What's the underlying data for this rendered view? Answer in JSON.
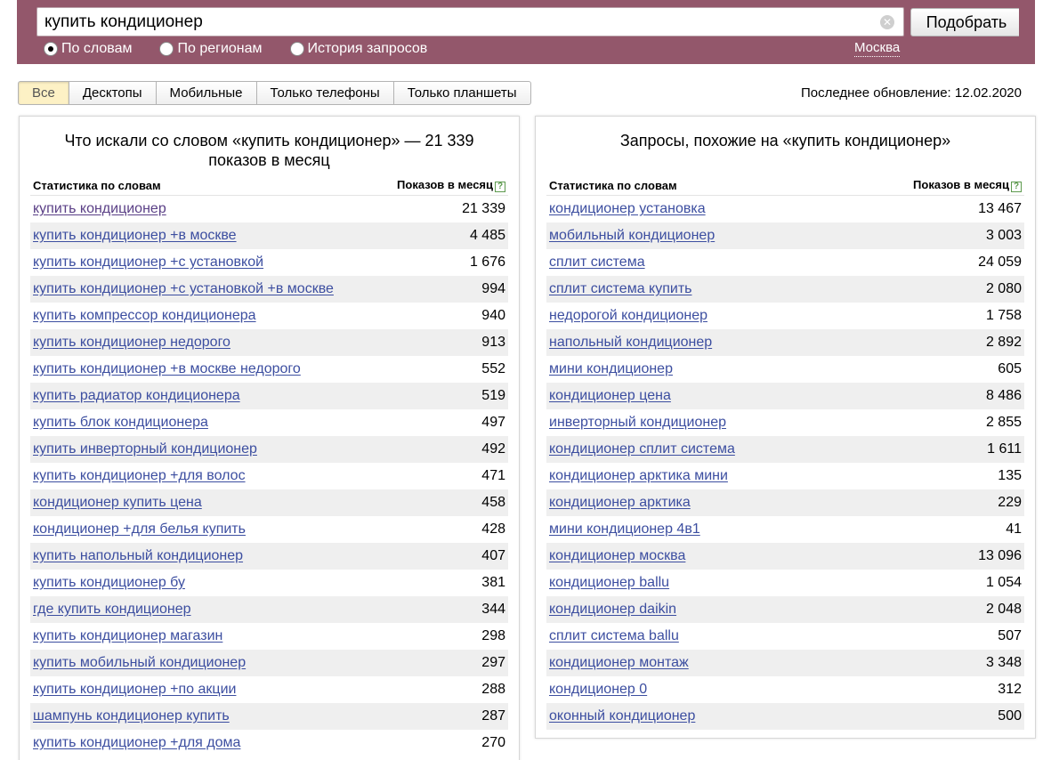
{
  "search": {
    "query": "купить кондиционер",
    "submit_label": "Подобрать",
    "modes": [
      {
        "label": "По словам",
        "checked": true
      },
      {
        "label": "По регионам",
        "checked": false
      },
      {
        "label": "История запросов",
        "checked": false
      }
    ],
    "region": "Москва",
    "colors": {
      "band": "#93576b"
    }
  },
  "tabs": [
    "Все",
    "Десктопы",
    "Мобильные",
    "Только телефоны",
    "Только планшеты"
  ],
  "active_tab": "Все",
  "last_update": "Последнее обновление: 12.02.2020",
  "left_panel": {
    "title": "Что искали со словом «купить кондиционер» — 21 339 показов в месяц",
    "col_words": "Статистика по словам",
    "col_count": "Показов в месяц",
    "rows": [
      {
        "phrase": "купить кондиционер",
        "count": "21 339"
      },
      {
        "phrase": "купить кондиционер +в москве",
        "count": "4 485"
      },
      {
        "phrase": "купить кондиционер +с установкой",
        "count": "1 676"
      },
      {
        "phrase": "купить кондиционер +с установкой +в москве",
        "count": "994"
      },
      {
        "phrase": "купить компрессор кондиционера",
        "count": "940"
      },
      {
        "phrase": "купить кондиционер недорого",
        "count": "913"
      },
      {
        "phrase": "купить кондиционер +в москве недорого",
        "count": "552"
      },
      {
        "phrase": "купить радиатор кондиционера",
        "count": "519"
      },
      {
        "phrase": "купить блок кондиционера",
        "count": "497"
      },
      {
        "phrase": "купить инверторный кондиционер",
        "count": "492"
      },
      {
        "phrase": "купить кондиционер +для волос",
        "count": "471"
      },
      {
        "phrase": "кондиционер купить цена",
        "count": "458"
      },
      {
        "phrase": "кондиционер +для белья купить",
        "count": "428"
      },
      {
        "phrase": "купить напольный кондиционер",
        "count": "407"
      },
      {
        "phrase": "купить кондиционер бу",
        "count": "381"
      },
      {
        "phrase": "где купить кондиционер",
        "count": "344"
      },
      {
        "phrase": "купить кондиционер магазин",
        "count": "298"
      },
      {
        "phrase": "купить мобильный кондиционер",
        "count": "297"
      },
      {
        "phrase": "купить кондиционер +по акции",
        "count": "288"
      },
      {
        "phrase": "шампунь кондиционер купить",
        "count": "287"
      },
      {
        "phrase": "купить кондиционер +для дома",
        "count": "270"
      }
    ]
  },
  "right_panel": {
    "title": "Запросы, похожие на «купить кондиционер»",
    "col_words": "Статистика по словам",
    "col_count": "Показов в месяц",
    "rows": [
      {
        "phrase": "кондиционер установка",
        "count": "13 467"
      },
      {
        "phrase": "мобильный кондиционер",
        "count": "3 003"
      },
      {
        "phrase": "сплит система",
        "count": "24 059"
      },
      {
        "phrase": "сплит система купить",
        "count": "2 080"
      },
      {
        "phrase": "недорогой кондиционер",
        "count": "1 758"
      },
      {
        "phrase": "напольный кондиционер",
        "count": "2 892"
      },
      {
        "phrase": "мини кондиционер",
        "count": "605"
      },
      {
        "phrase": "кондиционер цена",
        "count": "8 486"
      },
      {
        "phrase": "инверторный кондиционер",
        "count": "2 855"
      },
      {
        "phrase": "кондиционер сплит система",
        "count": "1 611"
      },
      {
        "phrase": "кондиционер арктика мини",
        "count": "135"
      },
      {
        "phrase": "кондиционер арктика",
        "count": "229"
      },
      {
        "phrase": "мини кондиционер 4в1",
        "count": "41"
      },
      {
        "phrase": "кондиционер москва",
        "count": "13 096"
      },
      {
        "phrase": "кондиционер ballu",
        "count": "1 054"
      },
      {
        "phrase": "кондиционер daikin",
        "count": "2 048"
      },
      {
        "phrase": "сплит система ballu",
        "count": "507"
      },
      {
        "phrase": "кондиционер монтаж",
        "count": "3 348"
      },
      {
        "phrase": "кондиционер 0",
        "count": "312"
      },
      {
        "phrase": "оконный кондиционер",
        "count": "500"
      }
    ]
  }
}
